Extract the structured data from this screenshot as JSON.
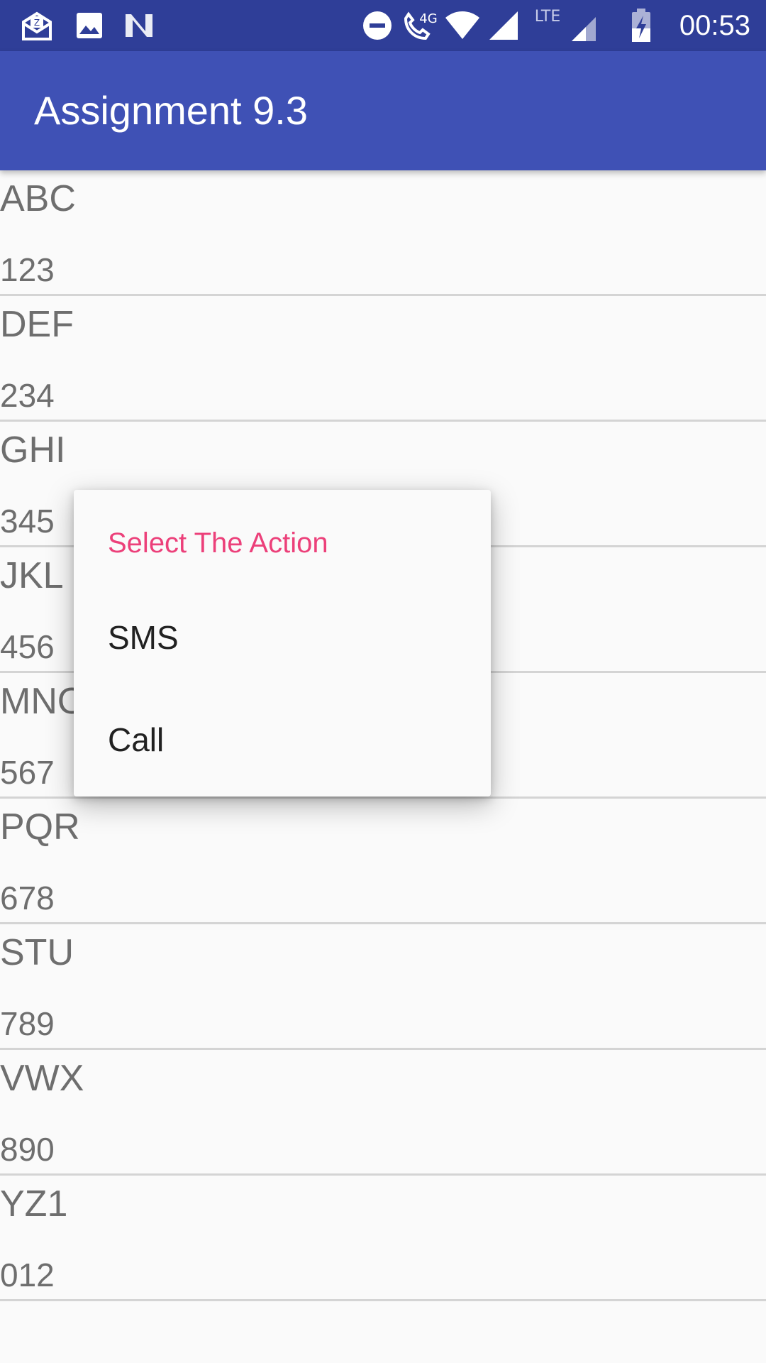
{
  "status_bar": {
    "time": "00:53",
    "left_icons": [
      "email-notification-icon",
      "image-notification-icon",
      "n-notification-icon"
    ],
    "right_icons": [
      "do-not-disturb-icon",
      "phone-4g-icon",
      "wifi-icon",
      "cell-signal-icon",
      "lte-signal-icon",
      "battery-charging-icon"
    ],
    "lte_label": "LTE",
    "phone_label": "4G"
  },
  "app_bar": {
    "title": "Assignment 9.3",
    "color": "#3f51b5"
  },
  "contacts": [
    {
      "name": "ABC",
      "number": "123"
    },
    {
      "name": "DEF",
      "number": "234"
    },
    {
      "name": "GHI",
      "number": "345"
    },
    {
      "name": "JKL",
      "number": "456"
    },
    {
      "name": "MNO",
      "number": "567"
    },
    {
      "name": "PQR",
      "number": "678"
    },
    {
      "name": "STU",
      "number": "789"
    },
    {
      "name": "VWX",
      "number": "890"
    },
    {
      "name": "YZ1",
      "number": "012"
    }
  ],
  "dialog": {
    "title": "Select The Action",
    "title_color": "#ec407a",
    "options": [
      "SMS",
      "Call"
    ]
  }
}
